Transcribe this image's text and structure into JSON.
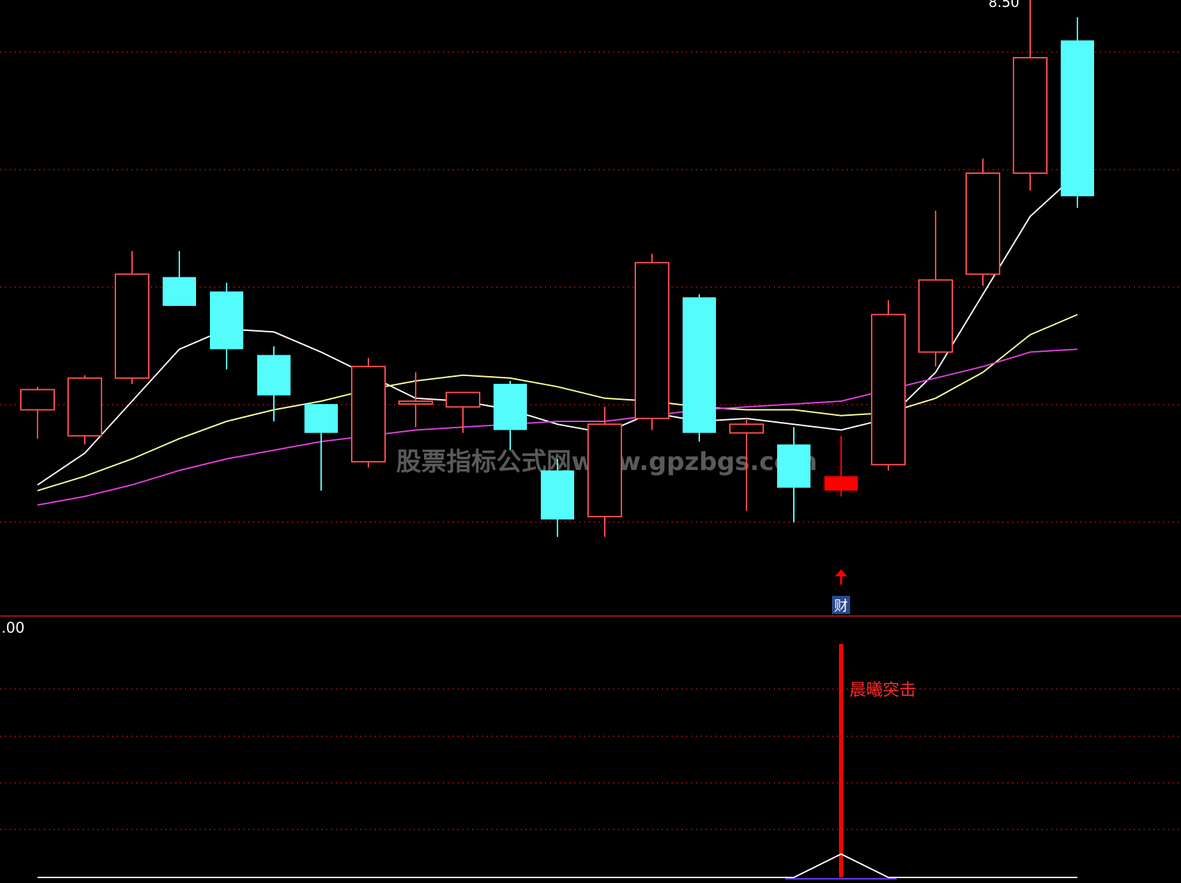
{
  "colors": {
    "background": "#000000",
    "up": "#ff4d4d",
    "up_signal": "#ff0000",
    "down": "#54fcfc",
    "grid": "#b01010",
    "divider": "#a01010",
    "ma5": "#ffffff",
    "ma10": "#ffff99",
    "ma20": "#e040e0",
    "watermark": "#5a5a5a",
    "signal_label": "#ff2a2a",
    "badge_bg": "#2c4a8c"
  },
  "labels": {
    "top_value": "8.50",
    "indicator_axis_value": ".00",
    "watermark": "股票指标公式网www.gpzbgs.com",
    "finance_badge": "财",
    "signal_label": "晨曦突击"
  },
  "chart_data": [
    {
      "type": "candlestick",
      "ylim": [
        6.5,
        8.62
      ],
      "grid": true,
      "candles": [
        {
          "o": 7.2,
          "h": 7.28,
          "l": 7.1,
          "c": 7.27
        },
        {
          "o": 7.11,
          "h": 7.32,
          "l": 7.08,
          "c": 7.31
        },
        {
          "o": 7.31,
          "h": 7.75,
          "l": 7.29,
          "c": 7.67
        },
        {
          "o": 7.66,
          "h": 7.75,
          "l": 7.57,
          "c": 7.56
        },
        {
          "o": 7.61,
          "h": 7.64,
          "l": 7.34,
          "c": 7.41
        },
        {
          "o": 7.39,
          "h": 7.42,
          "l": 7.16,
          "c": 7.25
        },
        {
          "o": 7.22,
          "h": 7.22,
          "l": 6.92,
          "c": 7.12
        },
        {
          "o": 7.02,
          "h": 7.38,
          "l": 7.0,
          "c": 7.35
        },
        {
          "o": 7.22,
          "h": 7.33,
          "l": 7.14,
          "c": 7.23
        },
        {
          "o": 7.21,
          "h": 7.25,
          "l": 7.12,
          "c": 7.26
        },
        {
          "o": 7.29,
          "h": 7.3,
          "l": 7.06,
          "c": 7.13
        },
        {
          "o": 6.99,
          "h": 7.03,
          "l": 6.76,
          "c": 6.82
        },
        {
          "o": 6.83,
          "h": 7.21,
          "l": 6.76,
          "c": 7.15
        },
        {
          "o": 7.17,
          "h": 7.74,
          "l": 7.13,
          "c": 7.71
        },
        {
          "o": 7.59,
          "h": 7.6,
          "l": 7.09,
          "c": 7.12
        },
        {
          "o": 7.12,
          "h": 7.17,
          "l": 6.85,
          "c": 7.15
        },
        {
          "o": 7.08,
          "h": 7.14,
          "l": 6.81,
          "c": 6.93
        },
        {
          "o": 6.92,
          "h": 7.11,
          "l": 6.9,
          "c": 6.97
        },
        {
          "o": 7.01,
          "h": 7.58,
          "l": 6.99,
          "c": 7.53
        },
        {
          "o": 7.4,
          "h": 7.89,
          "l": 7.35,
          "c": 7.65
        },
        {
          "o": 7.67,
          "h": 8.07,
          "l": 7.63,
          "c": 8.02
        },
        {
          "o": 8.02,
          "h": 8.62,
          "l": 7.96,
          "c": 8.42
        },
        {
          "o": 8.48,
          "h": 8.56,
          "l": 7.9,
          "c": 7.94
        }
      ],
      "signal_index": 17,
      "ma_series": [
        {
          "key": "ma5",
          "values": [
            6.94,
            7.05,
            7.23,
            7.41,
            7.48,
            7.47,
            7.4,
            7.32,
            7.24,
            7.23,
            7.2,
            7.15,
            7.12,
            7.19,
            7.16,
            7.17,
            7.15,
            7.13,
            7.17,
            7.33,
            7.6,
            7.87,
            8.02
          ]
        },
        {
          "key": "ma10",
          "values": [
            6.92,
            6.97,
            7.03,
            7.1,
            7.16,
            7.2,
            7.23,
            7.27,
            7.3,
            7.32,
            7.31,
            7.28,
            7.24,
            7.23,
            7.21,
            7.2,
            7.2,
            7.18,
            7.19,
            7.24,
            7.33,
            7.46,
            7.53
          ]
        },
        {
          "key": "ma20",
          "values": [
            6.87,
            6.9,
            6.94,
            6.99,
            7.03,
            7.06,
            7.09,
            7.11,
            7.13,
            7.14,
            7.15,
            7.16,
            7.16,
            7.18,
            7.2,
            7.21,
            7.22,
            7.23,
            7.27,
            7.31,
            7.35,
            7.4,
            7.41
          ]
        }
      ]
    },
    {
      "type": "bar",
      "ylim": [
        0,
        1
      ],
      "values": [
        0,
        0,
        0,
        0,
        0,
        0,
        0,
        0,
        0,
        0,
        0,
        0,
        0,
        0,
        0,
        0,
        0,
        1,
        0,
        0,
        0,
        0,
        0
      ],
      "line_values": [
        0,
        0,
        0,
        0,
        0,
        0,
        0,
        0,
        0,
        0,
        0,
        0,
        0,
        0,
        0,
        0,
        0,
        0.1,
        0,
        0,
        0,
        0,
        0
      ],
      "grid": true
    }
  ]
}
